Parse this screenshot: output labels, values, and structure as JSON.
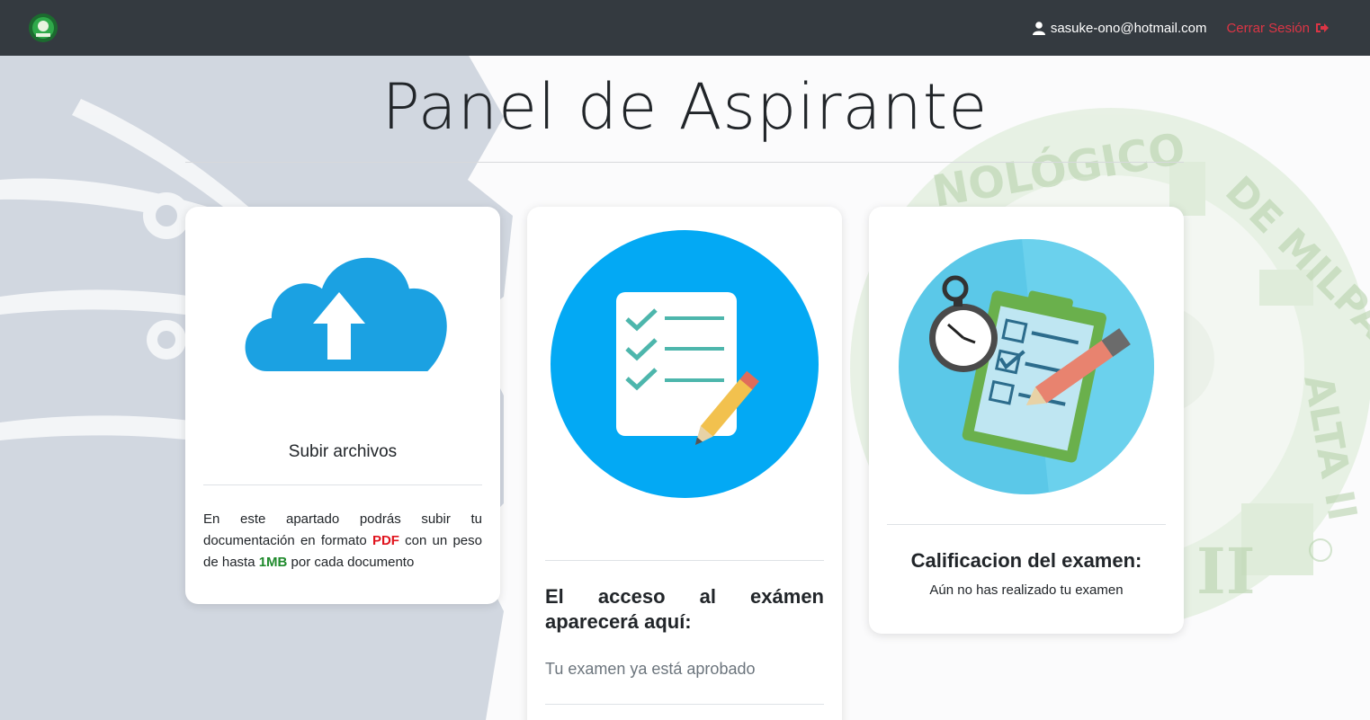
{
  "navbar": {
    "user_email": "sasuke-ono@hotmail.com",
    "logout_label": "Cerrar Sesión",
    "icons": {
      "user": "user-icon",
      "logout": "sign-out-icon",
      "logo": "institution-logo"
    }
  },
  "page": {
    "title": "Panel de Aspirante"
  },
  "cards": {
    "upload": {
      "title": "Subir archivos",
      "text_pre": "En este apartado podrás subir tu documentación en formato ",
      "text_pdf": "PDF",
      "text_mid": " con un peso de hasta ",
      "text_mb": "1MB",
      "text_post": " por cada documento",
      "icon": "cloud-upload-icon"
    },
    "exam": {
      "title": "El acceso al exámen aparecerá aquí:",
      "status": "Tu examen ya está aprobado",
      "icon": "checklist-icon"
    },
    "grade": {
      "title": "Calificacion del examen:",
      "status": "Aún no has realizado tu examen",
      "icon": "timed-test-icon"
    }
  },
  "background": {
    "watermark_text": "TECNOLÓGICO DE MILPA ALTA II"
  },
  "colors": {
    "navbar_bg": "#343a40",
    "logout": "#dc3545",
    "pdf": "#e0141e",
    "mb": "#1f8a2c",
    "accent_blue": "#03a9f4"
  }
}
